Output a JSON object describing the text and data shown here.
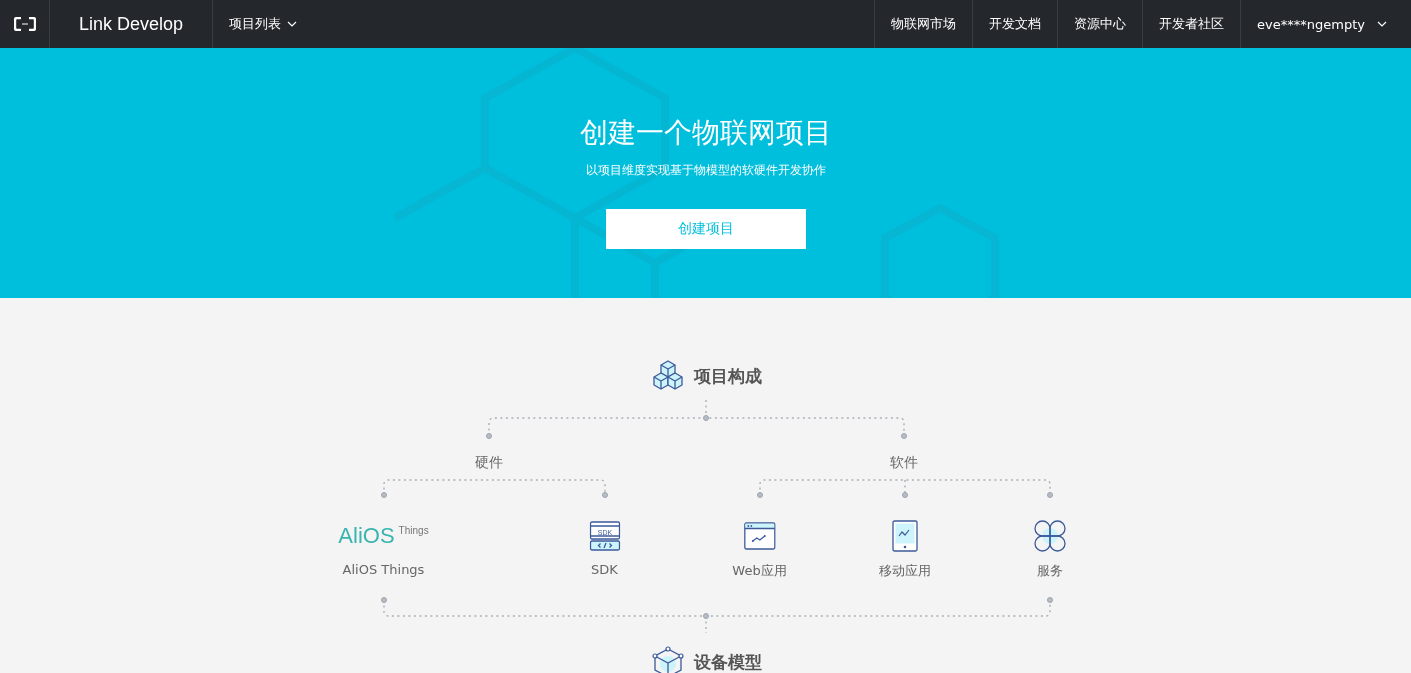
{
  "nav": {
    "brand": "Link Develop",
    "project_menu": "项目列表",
    "links": [
      "物联网市场",
      "开发文档",
      "资源中心",
      "开发者社区"
    ],
    "user": "eve****ngempty"
  },
  "hero": {
    "title": "创建一个物联网项目",
    "subtitle": "以项目维度实现基于物模型的软硬件开发协作",
    "button": "创建项目"
  },
  "diagram": {
    "title": "项目构成",
    "groups": [
      {
        "label": "硬件",
        "items": [
          {
            "kind": "alios",
            "label": "AliOS Things",
            "logo_main": "AliOS",
            "logo_sup": "Things"
          },
          {
            "kind": "sdk",
            "label": "SDK",
            "icon_text": "SDK"
          }
        ]
      },
      {
        "label": "软件",
        "items": [
          {
            "kind": "web",
            "label": "Web应用"
          },
          {
            "kind": "mobile",
            "label": "移动应用"
          },
          {
            "kind": "service",
            "label": "服务"
          }
        ]
      }
    ],
    "bottom_title": "设备模型"
  }
}
